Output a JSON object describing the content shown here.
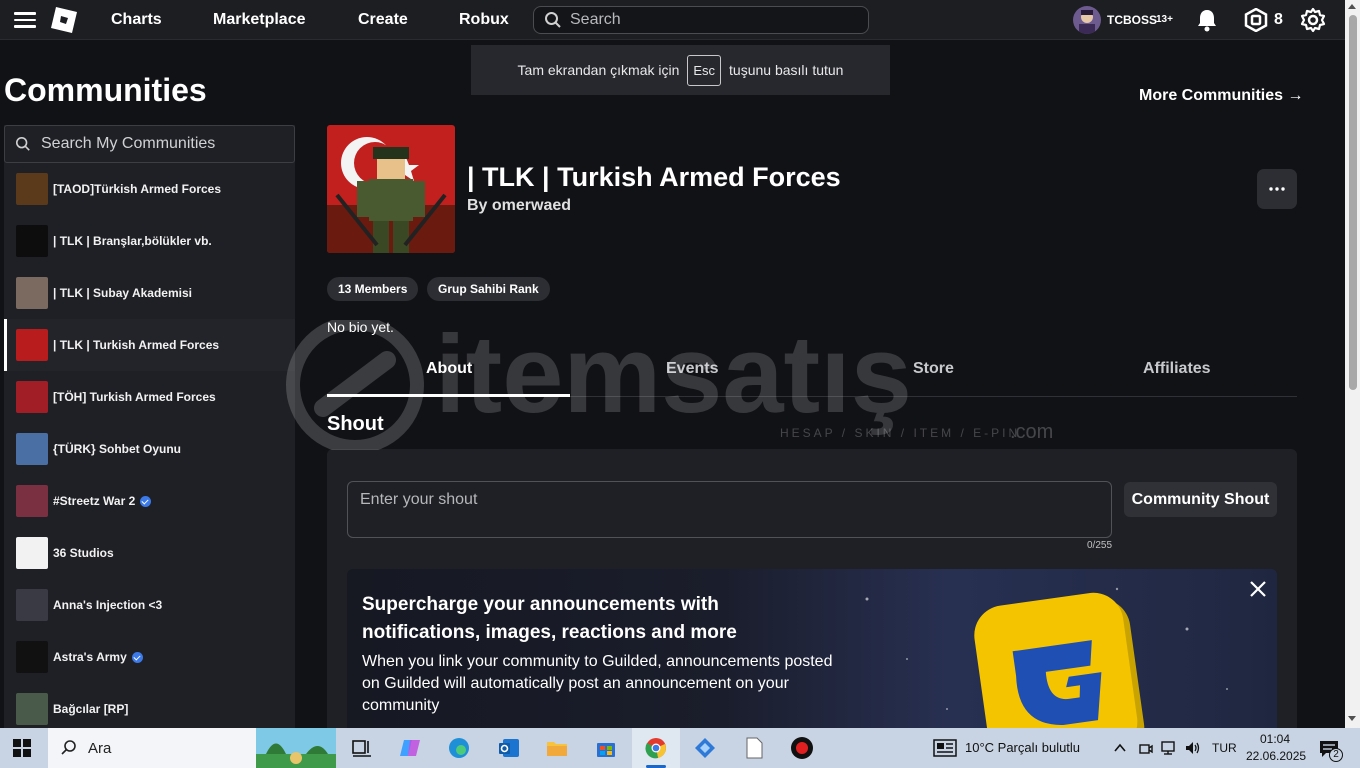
{
  "topnav": {
    "links": [
      "Charts",
      "Marketplace",
      "Create",
      "Robux"
    ],
    "search_placeholder": "Search",
    "username": "TCBOSS",
    "age_badge": "13+",
    "robux_count": "8"
  },
  "fullscreen_banner": {
    "before": "Tam ekrandan çıkmak için",
    "key": "Esc",
    "after": "tuşunu basılı tutun"
  },
  "page_title": "Communities",
  "sidebar": {
    "search_placeholder": "Search My Communities",
    "items": [
      {
        "label": "[TAOD]Türkish Armed Forces",
        "verified": false,
        "thumb_color": "#5a3a1a"
      },
      {
        "label": "| TLK | Branşlar,bölükler vb.",
        "verified": false,
        "thumb_color": "#0d0d0d"
      },
      {
        "label": "| TLK | Subay Akademisi",
        "verified": false,
        "thumb_color": "#7a6a60"
      },
      {
        "label": "| TLK | Turkish Armed Forces",
        "verified": false,
        "thumb_color": "#b81c1c",
        "active": true
      },
      {
        "label": "[TÖH] Turkish Armed Forces",
        "verified": false,
        "thumb_color": "#a21e26"
      },
      {
        "label": "{TÜRK} Sohbet Oyunu",
        "verified": false,
        "thumb_color": "#4a6fa5"
      },
      {
        "label": "#Streetz War 2",
        "verified": true,
        "thumb_color": "#7a3040"
      },
      {
        "label": "36 Studios",
        "verified": false,
        "thumb_color": "#f2f2f2"
      },
      {
        "label": "Anna's Injection <3",
        "verified": false,
        "thumb_color": "#3a3a44"
      },
      {
        "label": "Astra's Army",
        "verified": true,
        "thumb_color": "#111111"
      },
      {
        "label": "Bağcılar [RP]",
        "verified": false,
        "thumb_color": "#4a5a4a"
      }
    ]
  },
  "more_communities": "More Communities →",
  "group": {
    "name": "| TLK | Turkish Armed Forces",
    "owner": "By omerwaed",
    "members": "13 Members",
    "rank": "Grup Sahibi Rank",
    "bio": "No bio yet."
  },
  "tabs": [
    "About",
    "Events",
    "Store",
    "Affiliates"
  ],
  "shout": {
    "title": "Shout",
    "placeholder": "Enter your shout",
    "char_count": "0/255",
    "button": "Community Shout"
  },
  "guilded": {
    "title": "Supercharge your announcements with notifications, images, reactions and more",
    "body": "When you link your community to Guilded, announcements posted on Guilded will automatically post an announcement on your community"
  },
  "watermark": {
    "brand": "itemsatış",
    "tagline": "HESAP / SKIN / ITEM / E-PIN",
    "suffix": ".com"
  },
  "taskbar": {
    "search_placeholder": "Ara",
    "weather": "10°C  Parçalı bulutlu",
    "language": "TUR",
    "time": "01:04",
    "date": "22.06.2025",
    "notification_count": "2"
  }
}
